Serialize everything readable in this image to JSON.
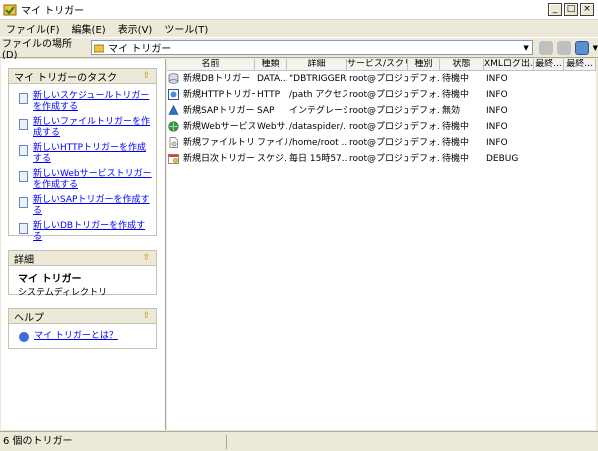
{
  "window": {
    "title": "マイ トリガー"
  },
  "window_buttons": [
    "_",
    "□",
    "×"
  ],
  "menu": [
    {
      "label": "ファイル(F)"
    },
    {
      "label": "編集(E)"
    },
    {
      "label": "表示(V)"
    },
    {
      "label": "ツール(T)"
    }
  ],
  "address": {
    "label": "ファイルの場所 (D)",
    "value": "マイ トリガー"
  },
  "tasks_panel": {
    "title": "マイ トリガーのタスク",
    "items": [
      {
        "label": "新しいスケジュールトリガーを作成する"
      },
      {
        "label": "新しいファイルトリガーを作成する"
      },
      {
        "label": "新しいHTTPトリガーを作成する"
      },
      {
        "label": "新しいWebサービストリガーを作成する"
      },
      {
        "label": "新しいSAPトリガーを作成する"
      },
      {
        "label": "新しいDBトリガーを作成する"
      }
    ]
  },
  "details_panel": {
    "title": "詳細",
    "name": "マイ トリガー",
    "type": "システムディレクトリ"
  },
  "help_panel": {
    "title": "ヘルプ",
    "link": "マイ トリガーとは？"
  },
  "columns": [
    "名前",
    "種類",
    "詳細",
    "サービス/スクリ...",
    "種別",
    "状態",
    "XMLログ出...",
    "最終...",
    "最終..."
  ],
  "rows": [
    {
      "icon": "db-trigger-icon",
      "name": "新規DBトリガー",
      "type": "DATA...",
      "detail": "\"DBTRIGGER...",
      "service": "root@プロジェク...",
      "kind": "デフォ...",
      "status": "待機中",
      "xmllog": "INFO"
    },
    {
      "icon": "http-trigger-icon",
      "name": "新規HTTPトリガー",
      "type": "HTTP",
      "detail": "/path アクセス...",
      "service": "root@プロジェク...",
      "kind": "デフォ...",
      "status": "待機中",
      "xmllog": "INFO"
    },
    {
      "icon": "sap-trigger-icon",
      "name": "新規SAPトリガー",
      "type": "SAP",
      "detail": "インテグレーショ...",
      "service": "root@プロジェク...",
      "kind": "デフォ...",
      "status": "無効",
      "xmllog": "INFO"
    },
    {
      "icon": "web-trigger-icon",
      "name": "新規Webサービスト...",
      "type": "Webサ...",
      "detail": "/dataspider/...",
      "service": "root@プロジェク...",
      "kind": "デフォ...",
      "status": "待機中",
      "xmllog": "INFO"
    },
    {
      "icon": "file-trigger-icon",
      "name": "新規ファイルトリガー",
      "type": "ファイル",
      "detail": "/home/root ...",
      "service": "root@プロジェク...",
      "kind": "デフォ...",
      "status": "待機中",
      "xmllog": "INFO"
    },
    {
      "icon": "schedule-trigger-icon",
      "name": "新規日次トリガー",
      "type": "スケジ...",
      "detail": "毎日 15時57...",
      "service": "root@プロジェク...",
      "kind": "デフォ...",
      "status": "待機中",
      "xmllog": "DEBUG"
    }
  ],
  "status_bar": {
    "text": "6 個のトリガー"
  }
}
